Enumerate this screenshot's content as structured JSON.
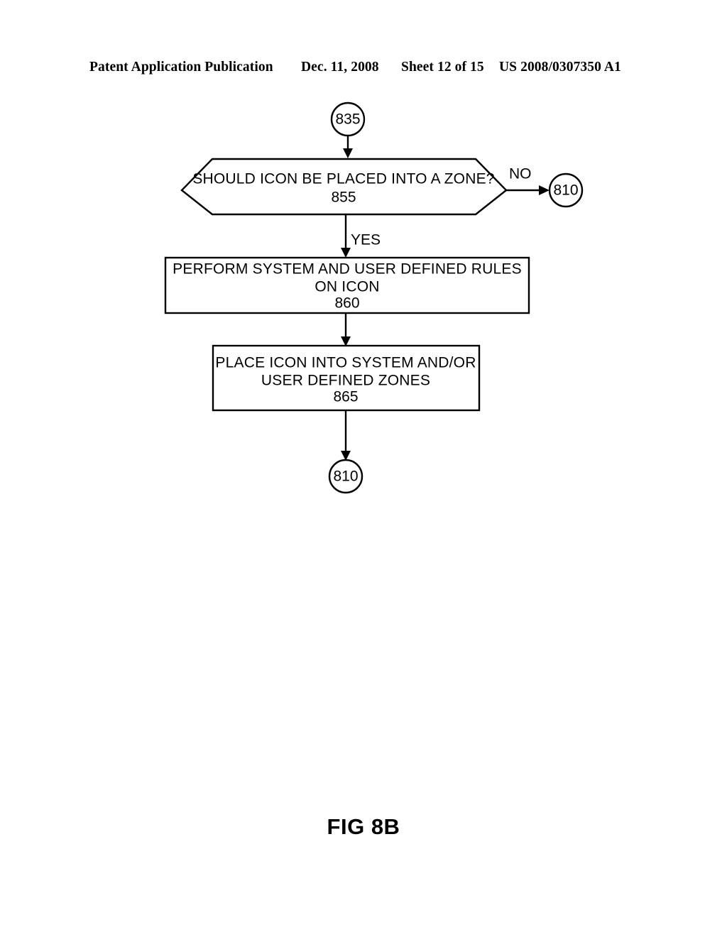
{
  "header": {
    "publication": "Patent Application Publication",
    "date": "Dec. 11, 2008",
    "sheet": "Sheet 12 of 15",
    "patent_number": "US 2008/0307350 A1"
  },
  "figure": {
    "caption": "FIG 8B",
    "nodes": {
      "entry_connector": {
        "label": "835"
      },
      "decision": {
        "text": "SHOULD ICON BE PLACED INTO A ZONE?",
        "ref": "855"
      },
      "no_connector": {
        "label": "810"
      },
      "process_rules": {
        "line1": "PERFORM SYSTEM AND USER DEFINED RULES",
        "line2": "ON ICON",
        "ref": "860"
      },
      "process_place": {
        "line1": "PLACE ICON INTO SYSTEM AND/OR",
        "line2": "USER DEFINED ZONES",
        "ref": "865"
      },
      "exit_connector": {
        "label": "810"
      }
    },
    "branches": {
      "no_label": "NO",
      "yes_label": "YES"
    }
  },
  "colors": {
    "ink": "#000000",
    "paper": "#ffffff"
  }
}
